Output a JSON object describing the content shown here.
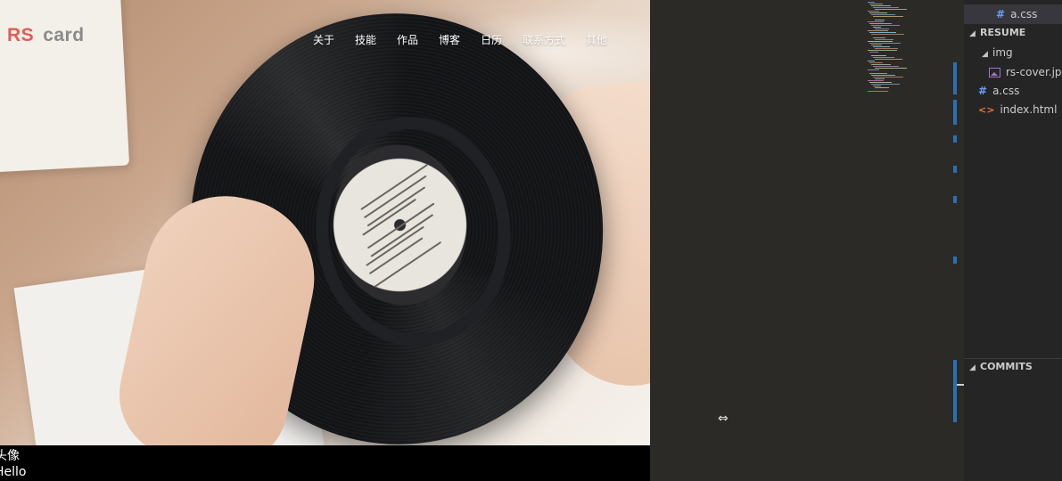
{
  "preview": {
    "logo": {
      "rs": "RS",
      "card": "card"
    },
    "nav": [
      "关于",
      "技能",
      "作品",
      "博客",
      "日历",
      "联系方式",
      "其他"
    ],
    "avatar_text": "头像",
    "hello_text": "Hello"
  },
  "editor": {
    "resize_cursor_icon": "resize-horizontal-icon"
  },
  "sidebar": {
    "open_editor_file": "a.css",
    "section_resume": "RESUME",
    "folder_img": "img",
    "file_cover": "rs-cover.jpg",
    "file_css": "a.css",
    "file_html": "index.html",
    "section_commits": "COMMITS"
  },
  "colors": {
    "logo_accent": "#e05c55",
    "css_icon": "#6c9ef8",
    "html_icon": "#e37933",
    "image_icon": "#a074c4"
  }
}
